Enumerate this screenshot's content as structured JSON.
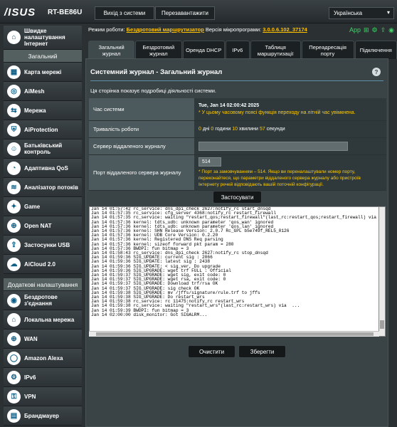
{
  "header": {
    "logo": "/ISUS",
    "model": "RT-BE86U",
    "logout": "Вихід з системи",
    "reboot": "Перезавантажити",
    "language": "Українська"
  },
  "status": {
    "mode_label": "Режим роботи:",
    "mode_value": "Бездротовий маршрутизатор",
    "fw_label": "Версія мікропрограми:",
    "fw_value": "3.0.0.6.102_37174",
    "app_label": "App"
  },
  "sidebar": {
    "quick": "Швидке налаштування Інтернет",
    "general_header": "Загальний",
    "general": [
      {
        "label": "Карта мережі",
        "icon": "network-map-icon"
      },
      {
        "label": "AiMesh",
        "icon": "aimesh-icon"
      },
      {
        "label": "Мережа",
        "icon": "network-icon"
      },
      {
        "label": "AiProtection",
        "icon": "shield-icon"
      },
      {
        "label": "Батьківський контроль",
        "icon": "parental-control-icon"
      },
      {
        "label": "Адаптивна QoS",
        "icon": "qos-icon"
      },
      {
        "label": "Аналізатор потоків",
        "icon": "traffic-analyzer-icon"
      },
      {
        "label": "Game",
        "icon": "gamepad-icon"
      },
      {
        "label": "Open NAT",
        "icon": "open-nat-icon"
      },
      {
        "label": "Застосунки USB",
        "icon": "usb-icon"
      },
      {
        "label": "AiCloud 2.0",
        "icon": "cloud-icon"
      }
    ],
    "advanced_header": "Додаткові налаштування",
    "advanced": [
      {
        "label": "Бездротове з'єднання",
        "icon": "wireless-icon"
      },
      {
        "label": "Локальна мережа",
        "icon": "lan-icon"
      },
      {
        "label": "WAN",
        "icon": "wan-icon"
      },
      {
        "label": "Amazon Alexa",
        "icon": "alexa-icon"
      },
      {
        "label": "IPv6",
        "icon": "ipv6-icon"
      },
      {
        "label": "VPN",
        "icon": "vpn-icon"
      },
      {
        "label": "Брандмауер",
        "icon": "firewall-icon"
      }
    ]
  },
  "tabs": [
    "Загальний журнал",
    "Бездротовий журнал",
    "Оренда DHCP",
    "IPv6",
    "Таблиця маршрутизації",
    "Переадресація порту",
    "Підключення"
  ],
  "panel": {
    "title": "Системний журнал - Загальний журнал",
    "description": "Ця сторінка показує подробиці діяльності системи.",
    "system_time_label": "Час системи",
    "system_time_value": "Tue, Jan 14 02:00:42 2025",
    "system_time_note": "* У цьому часовому поясі функція переходу на літній час увімкнена.",
    "uptime_label": "Тривалість роботи",
    "uptime": {
      "days": "0",
      "days_unit": "дні",
      "hours": "0",
      "hours_unit": "години",
      "minutes": "10",
      "minutes_unit": "хвилини",
      "seconds": "57",
      "seconds_unit": "секунди"
    },
    "remote_server_label": "Сервер віддаленого журналу",
    "remote_server_value": "",
    "remote_port_label": "Порт віддаленого сервера журналу",
    "remote_port_value": "514",
    "remote_port_note": "* Порт за замовчуванням – 514. Якщо ви переналаштували номер порту, переконайтеся, що параметри віддаленого сервера журналу або пристроїв Інтернету речей відповідають вашій поточній конфігурації.",
    "apply": "Застосувати",
    "clear": "Очистити",
    "save": "Зберегти"
  },
  "log": "Jan 14 01:57:42 rc_service: dns_dpi_check 2627:notify_rc start_dnsqd\nJan 14 01:57:35 rc_service: cfg_server 4368:notify_rc restart_firewall\nJan 14 01:57:35 rc_service: waiting \"restart_qos;restart_firewall\"(last_rc:restart_qos;restart_firewall) via\nJan 14 01:57:36 kernel: tdts_udb: unknown parameter 'qos_wan' ignored\nJan 14 01:57:36 kernel: tdts_udb: unknown parameter 'qos_lan' ignored\nJan 14 01:57:36 kernel: SHN Release Version: 2.0.7 Rc_GPL b5e749f_REL5_0126\nJan 14 01:57:36 kernel: UDB Core Version: 0.2.20\nJan 14 01:57:36 kernel: Registered DNS Req parsing\nJan 14 01:57:36 kernel: sizeof forward pkt param = 280\nJan 14 01:57:36 BWDPI: fun bitmap = 3\nJan 14 01:58:43 rc_service: dns_dpi_check 2627:notify_rc stop_dnsqd\nJan 14 01:59:36 SIG_UPDATE: current sig : 2066\nJan 14 01:59:36 SIG_UPDATE: latest sig : 2438\nJan 14 01:59:36 SIG_UPDATE: < sig_ver, Do upgrade\nJan 14 01:59:36 SIG_UPGRADE: wget trf FULL : Official\nJan 14 01:59:37 SIG_UPGRADE: wget sig, exit code: 0\nJan 14 01:59:37 SIG_UPGRADE: wget rsa, exit code: 0\nJan 14 01:59:37 SIG_UPGRADE: Download trf/rsa OK\nJan 14 01:59:37 SIG_UPGRADE: sig check OK\nJan 14 01:59:38 SIG_UPGRADE: mv /jffs/signature/rule.trf to jffs\nJan 14 01:59:38 SIG_UPGRADE: Do restart_wrs\nJan 14 01:59:38 rc_service: rc 11475:notify_rc restart_wrs\nJan 14 01:59:38 rc_service: waiting \"restart_wrs\"(last_rc:restart_wrs) via  ...\nJan 14 01:59:39 BWDPI: fun bitmap = 3\nJan 14 02:00:00 disk_monitor: Got SIGALRM..."
}
